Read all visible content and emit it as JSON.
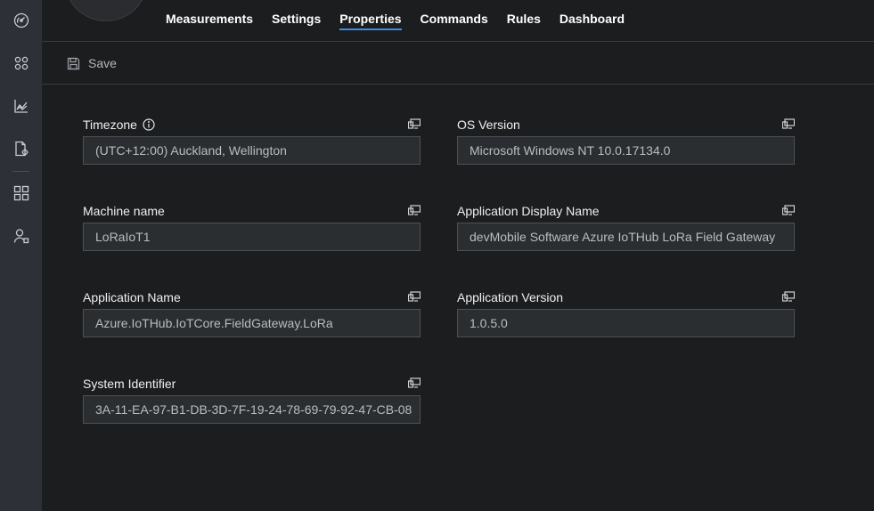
{
  "tabs": [
    {
      "label": "Measurements",
      "active": false
    },
    {
      "label": "Settings",
      "active": false
    },
    {
      "label": "Properties",
      "active": true
    },
    {
      "label": "Commands",
      "active": false
    },
    {
      "label": "Rules",
      "active": false
    },
    {
      "label": "Dashboard",
      "active": false
    }
  ],
  "toolbar": {
    "save_label": "Save"
  },
  "rail": {
    "items": [
      "dashboard-gauge-icon",
      "devices-grid-icon",
      "analytics-chart-icon",
      "device-templates-icon",
      "apps-grid-icon",
      "administration-user-icon"
    ]
  },
  "properties": {
    "timezone": {
      "label": "Timezone",
      "value": "(UTC+12:00) Auckland, Wellington"
    },
    "os_version": {
      "label": "OS Version",
      "value": "Microsoft Windows NT 10.0.17134.0"
    },
    "machine_name": {
      "label": "Machine name",
      "value": "LoRaIoT1"
    },
    "app_display_name": {
      "label": "Application Display Name",
      "value": "devMobile Software Azure IoTHub LoRa Field Gateway"
    },
    "app_name": {
      "label": "Application Name",
      "value": "Azure.IoTHub.IoTCore.FieldGateway.LoRa"
    },
    "app_version": {
      "label": "Application Version",
      "value": "1.0.5.0"
    },
    "system_identifier": {
      "label": "System Identifier",
      "value": "3A-11-EA-97-B1-DB-3D-7F-19-24-78-69-79-92-47-CB-08"
    }
  },
  "colors": {
    "rail_bg": "#2d3137",
    "main_bg": "#1b1d1f",
    "accent": "#3b8eea",
    "input_bg": "#2b2e31"
  }
}
